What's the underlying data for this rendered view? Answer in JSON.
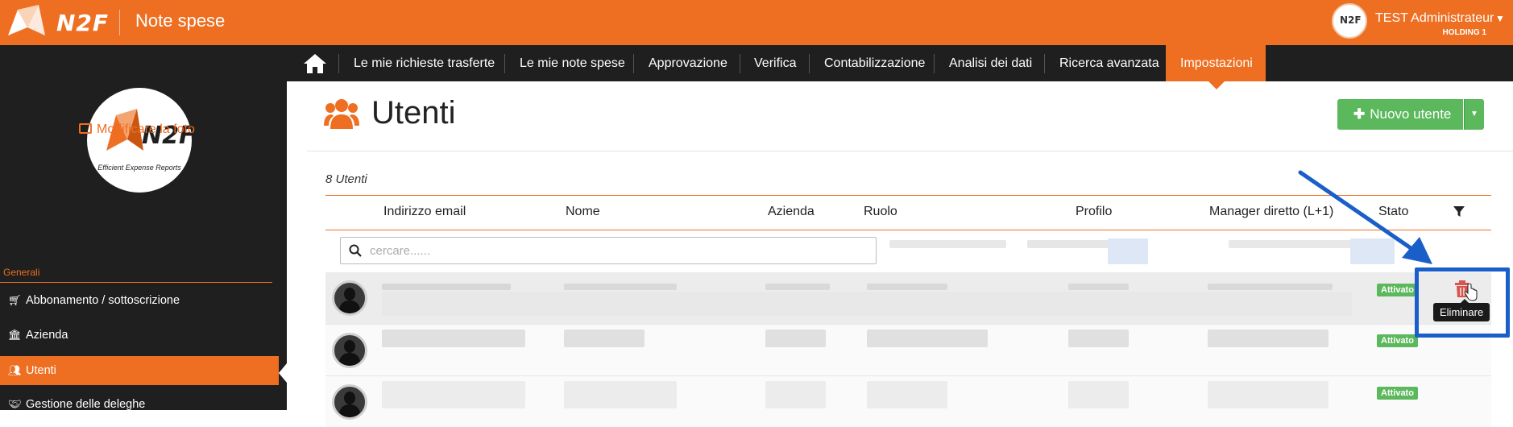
{
  "header": {
    "logo_text": "N2F",
    "app_title": "Note spese",
    "user_name": "TEST Administrateur",
    "user_company": "HOLDING 1",
    "avatar_text": "N2F"
  },
  "nav": {
    "items": [
      {
        "label": "Le mie richieste trasferte"
      },
      {
        "label": "Le mie note spese"
      },
      {
        "label": "Approvazione"
      },
      {
        "label": "Verifica"
      },
      {
        "label": "Contabilizzazione"
      },
      {
        "label": "Analisi dei dati"
      },
      {
        "label": "Ricerca avanzata"
      },
      {
        "label": "Impostazioni"
      }
    ],
    "active": "Impostazioni"
  },
  "sidebar": {
    "logo_text": "N2F",
    "logo_tagline": "Efficient Expense Reports",
    "photo_link": "Modificare la foto",
    "section": "Generali",
    "items": [
      {
        "label": "Abbonamento / sottoscrizione",
        "icon": "cart-icon"
      },
      {
        "label": "Azienda",
        "icon": "bank-icon"
      },
      {
        "label": "Utenti",
        "icon": "users-icon"
      },
      {
        "label": "Gestione delle deleghe",
        "icon": "handshake-icon"
      }
    ]
  },
  "main": {
    "title": "Utenti",
    "new_button": "Nuovo utente",
    "count": "8 Utenti",
    "columns": [
      "Indirizzo email",
      "Nome",
      "Azienda",
      "Ruolo",
      "Profilo",
      "Manager diretto (L+1)",
      "Stato"
    ],
    "search_placeholder": "cercare......",
    "rows": [
      {
        "status": "Attivato"
      },
      {
        "status": "Attivato"
      },
      {
        "status": "Attivato"
      }
    ],
    "tooltip": "Eliminare"
  },
  "colors": {
    "brand": "#ee6f22",
    "nav_bg": "#1f1f1f",
    "success": "#5cb85c",
    "annotation": "#1a5fc9",
    "danger": "#d9534f"
  }
}
